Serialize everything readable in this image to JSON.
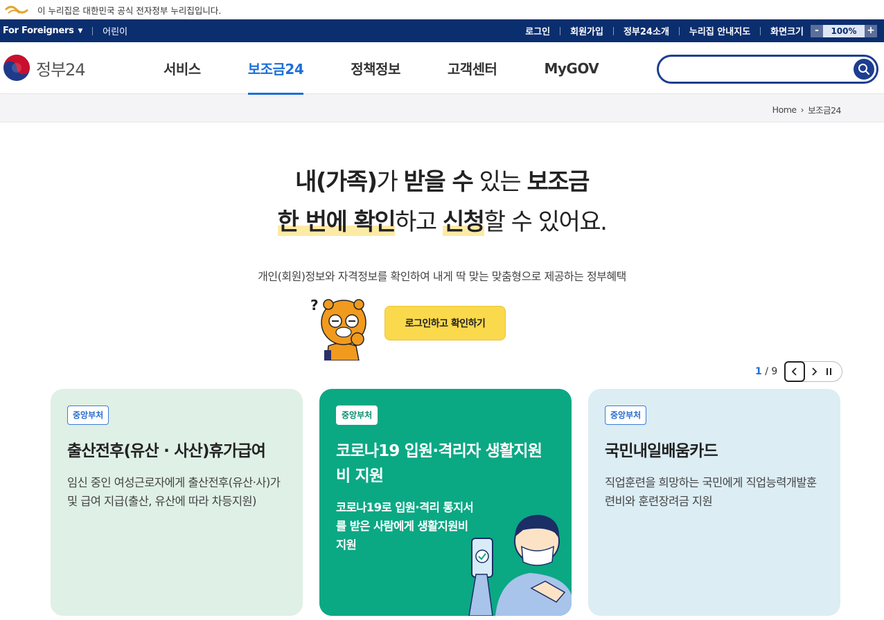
{
  "gov_banner": {
    "text": "이 누리집은 대한민국 공식 전자정부 누리집입니다."
  },
  "utility": {
    "lang_label": "For Foreigners",
    "kids_label": "어린이",
    "links": [
      "로그인",
      "회원가입",
      "정부24소개",
      "누리집 안내지도"
    ],
    "zoom_label": "화면크기",
    "zoom_minus": "-",
    "zoom_value": "100%",
    "zoom_plus": "+"
  },
  "header": {
    "logo_text": "정부24",
    "nav": [
      "서비스",
      "보조금24",
      "정책정보",
      "고객센터",
      "MyGOV"
    ],
    "active_nav": "보조금24",
    "search_value": "",
    "search_icon": "search-icon"
  },
  "breadcrumb": {
    "home": "Home",
    "current": "보조금24"
  },
  "hero": {
    "line1": [
      "내(가족)",
      "가 ",
      "받을 수",
      " 있는 ",
      "보조금"
    ],
    "line2": [
      "한 번에 확인",
      "하고 ",
      "신청",
      "할 수 있어요."
    ],
    "subtitle": "개인(회원)정보와 자격정보를 확인하여 내게 딱 맞는 맞춤형으로 제공하는 정부혜택",
    "login_button": "로그인하고 확인하기"
  },
  "carousel": {
    "current": "1",
    "total": "/ 9"
  },
  "cards": [
    {
      "tag": "중앙부처",
      "title": "출산전후(유산 · 사산)휴가급여",
      "desc": "임신 중인 여성근로자에게 출산전후(유산·사)가 및 급여 지급(출산, 유산에 따라 차등지원)",
      "bg": "#dff0e6"
    },
    {
      "tag": "중앙부처",
      "title": "코로나19 입원·격리자 생활지원비 지원",
      "desc": "코로나19로 입원·격리 통지서를 받은 사람에게 생활지원비 지원",
      "bg": "#0ba884"
    },
    {
      "tag": "중앙부처",
      "title": "국민내일배움카드",
      "desc": "직업훈련을 희망하는 국민에게 직업능력개발훈련비와 훈련장려금 지원",
      "bg": "#dcedf4"
    }
  ],
  "colors": {
    "utility_bar": "#0b2e6f",
    "accent": "#1c6fd8",
    "login_button": "#fbd94c"
  }
}
